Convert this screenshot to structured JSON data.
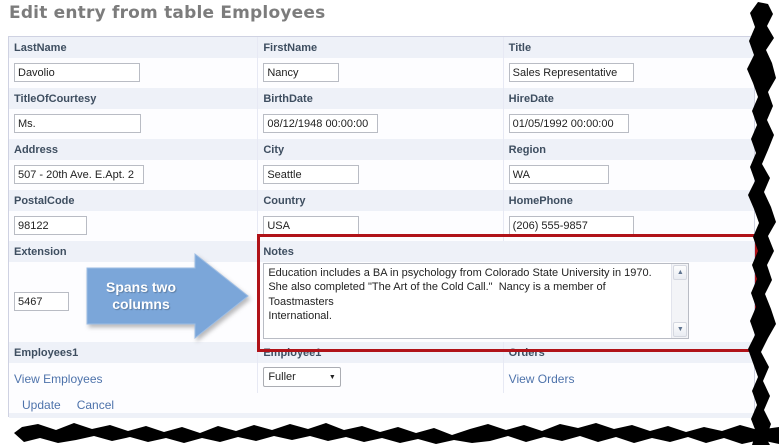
{
  "page": {
    "title": "Edit entry from table Employees"
  },
  "form": {
    "fields": {
      "lastName": {
        "label": "LastName",
        "value": "Davolio"
      },
      "firstName": {
        "label": "FirstName",
        "value": "Nancy"
      },
      "title": {
        "label": "Title",
        "value": "Sales Representative"
      },
      "titleOfCourtesy": {
        "label": "TitleOfCourtesy",
        "value": "Ms."
      },
      "birthDate": {
        "label": "BirthDate",
        "value": "08/12/1948 00:00:00"
      },
      "hireDate": {
        "label": "HireDate",
        "value": "01/05/1992 00:00:00"
      },
      "address": {
        "label": "Address",
        "value": "507 - 20th Ave. E.Apt. 2"
      },
      "city": {
        "label": "City",
        "value": "Seattle"
      },
      "region": {
        "label": "Region",
        "value": "WA"
      },
      "postalCode": {
        "label": "PostalCode",
        "value": "98122"
      },
      "country": {
        "label": "Country",
        "value": "USA"
      },
      "homePhone": {
        "label": "HomePhone",
        "value": "(206) 555-9857"
      },
      "extension": {
        "label": "Extension",
        "value": "5467"
      },
      "notes": {
        "label": "Notes",
        "value": "Education includes a BA in psychology from Colorado State University in 1970.\nShe also completed \"The Art of the Cold Call.\"  Nancy is a member of Toastmasters\nInternational."
      },
      "employees1": {
        "label": "Employees1",
        "link": "View Employees"
      },
      "employee1": {
        "label": "Employee1",
        "selected": "Fuller"
      },
      "orders": {
        "label": "Orders",
        "link": "View Orders"
      }
    },
    "actions": {
      "update": "Update",
      "cancel": "Cancel"
    }
  },
  "annotation": {
    "arrow_text": "Spans two columns",
    "highlight_color": "#b01218",
    "arrow_fill": "#7ba6d9",
    "arrow_stroke": "#9dbde4"
  },
  "icons": {
    "dropdown_arrow": "▼",
    "scroll_up": "▲",
    "scroll_down": "▼"
  }
}
